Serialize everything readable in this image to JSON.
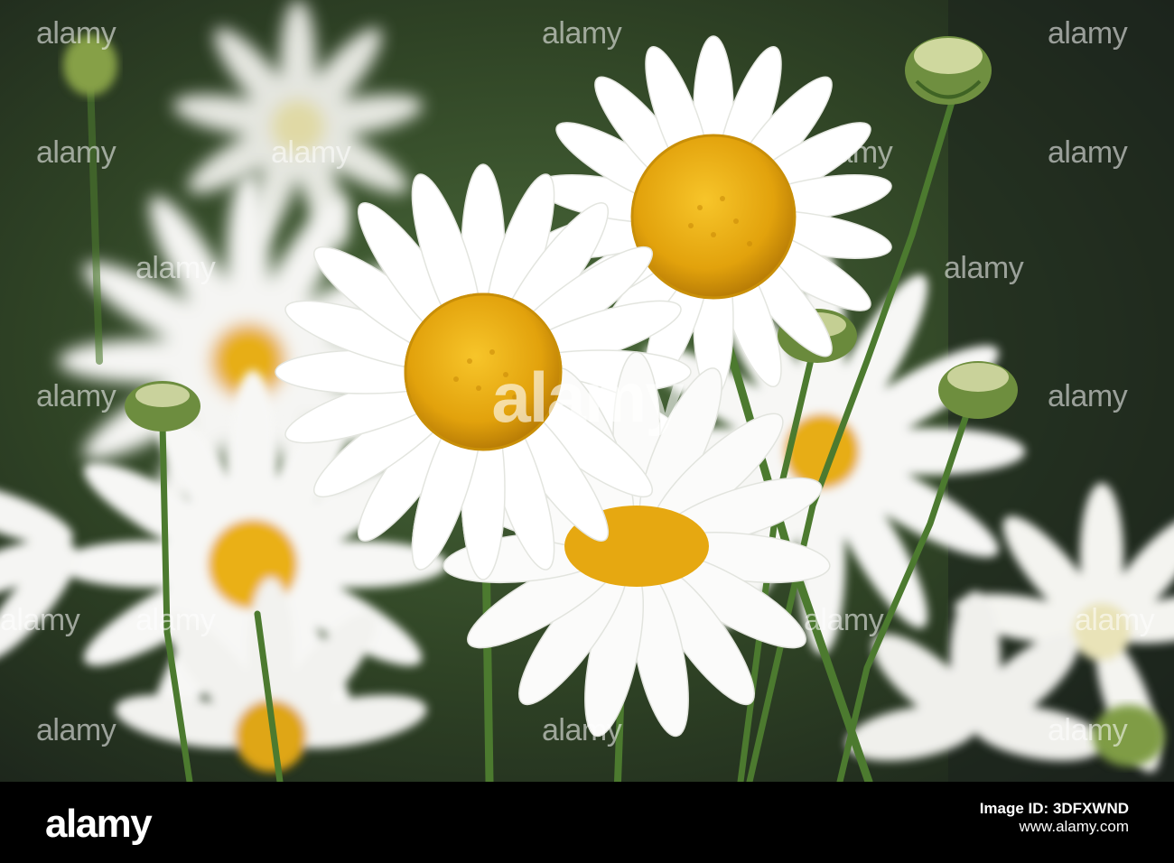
{
  "photo": {
    "subject": "white daisies with yellow centres",
    "colors": {
      "background_dark": "#1f2a1f",
      "foliage": "#3d5b2c",
      "petal": "#ffffff",
      "center": "#e8ad10",
      "stem": "#4c7a2f"
    }
  },
  "watermark": {
    "text": "alamy",
    "big_text": "alamy"
  },
  "footer": {
    "logo": "alamy",
    "image_id_label": "Image ID: 3DFXWND",
    "site": "www.alamy.com"
  }
}
